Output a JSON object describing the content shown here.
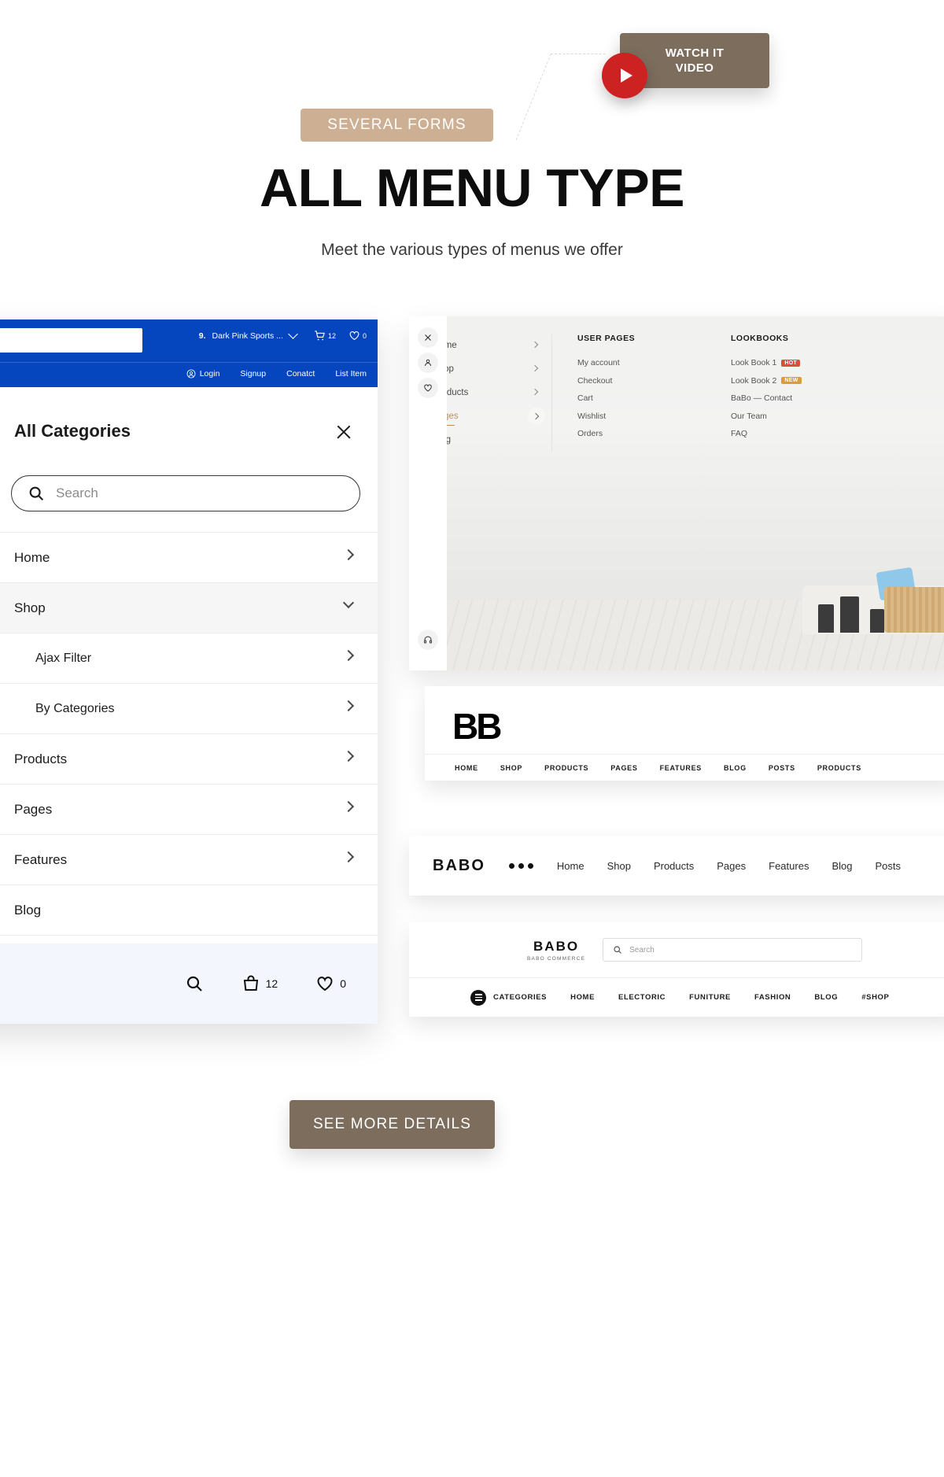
{
  "hero": {
    "watch_button": {
      "label": "WATCH IT VIDEO",
      "icon": "play-icon"
    },
    "badge": "SEVERAL FORMS",
    "title": "ALL MENU TYPE",
    "subtitle": "Meet the various types of menus we offer"
  },
  "blue_nav": {
    "search_value": "",
    "search_placeholder": "",
    "product_select": {
      "index": "9.",
      "label": "Dark Pink Sports ..."
    },
    "cart": {
      "icon": "cart-icon",
      "count": "12"
    },
    "wishlist": {
      "icon": "heart-icon",
      "count": "0"
    },
    "links": [
      {
        "label": "Login",
        "icon": "user-circle-icon"
      },
      {
        "label": "Signup",
        "icon": ""
      },
      {
        "label": "Conatct",
        "icon": ""
      },
      {
        "label": "List Item",
        "icon": ""
      }
    ]
  },
  "offcanvas": {
    "title": "All Categories",
    "close_icon": "close-icon",
    "search_placeholder": "Search",
    "search_icon": "search-icon",
    "items": [
      {
        "label": "Home",
        "arrow": "chevron-right-icon",
        "sub": false,
        "active": false
      },
      {
        "label": "Shop",
        "arrow": "chevron-down-icon",
        "sub": false,
        "active": true
      },
      {
        "label": "Ajax Filter",
        "arrow": "chevron-right-icon",
        "sub": true,
        "active": false
      },
      {
        "label": "By Categories",
        "arrow": "chevron-right-icon",
        "sub": true,
        "active": false
      },
      {
        "label": "Products",
        "arrow": "chevron-right-icon",
        "sub": false,
        "active": false
      },
      {
        "label": "Pages",
        "arrow": "chevron-right-icon",
        "sub": false,
        "active": false
      },
      {
        "label": "Features",
        "arrow": "chevron-right-icon",
        "sub": false,
        "active": false
      },
      {
        "label": "Blog",
        "arrow": "",
        "sub": false,
        "active": false
      }
    ],
    "bottom_bar": {
      "search_icon": "search-icon",
      "cart": {
        "icon": "bag-icon",
        "count": "12"
      },
      "wishlist": {
        "icon": "heart-icon",
        "count": "0"
      }
    }
  },
  "mega_menu": {
    "rail": [
      "close-icon",
      "user-icon",
      "heart-icon",
      "headphones-icon"
    ],
    "main_items": [
      {
        "label": "Home",
        "selected": false
      },
      {
        "label": "Shop",
        "selected": false
      },
      {
        "label": "Products",
        "selected": false
      },
      {
        "label": "Pages",
        "selected": true
      },
      {
        "label": "Blog",
        "selected": false
      }
    ],
    "columns": [
      {
        "heading": "USER PAGES",
        "items": [
          {
            "label": "My account",
            "tag": ""
          },
          {
            "label": "Checkout",
            "tag": ""
          },
          {
            "label": "Cart",
            "tag": ""
          },
          {
            "label": "Wishlist",
            "tag": ""
          },
          {
            "label": "Orders",
            "tag": ""
          }
        ]
      },
      {
        "heading": "LOOKBOOKS",
        "items": [
          {
            "label": "Look Book 1",
            "tag": "HOT"
          },
          {
            "label": "Look Book 2",
            "tag": "NEW"
          },
          {
            "label": "BaBo — Contact",
            "tag": ""
          },
          {
            "label": "Our Team",
            "tag": ""
          },
          {
            "label": "FAQ",
            "tag": ""
          }
        ]
      }
    ]
  },
  "bb_card": {
    "logo": "BB",
    "nav": [
      "HOME",
      "SHOP",
      "PRODUCTS",
      "PAGES",
      "FEATURES",
      "BLOG",
      "POSTS",
      "PRODUCTS"
    ]
  },
  "babo_card": {
    "logo": "BABO",
    "dots_icon": "more-dots-icon",
    "nav": [
      "Home",
      "Shop",
      "Products",
      "Pages",
      "Features",
      "Blog",
      "Posts"
    ]
  },
  "commerce_card": {
    "logo_main": "BABO",
    "logo_sub": "BABO COMMERCE",
    "search_placeholder": "Search",
    "search_icon": "search-icon",
    "categories_label": "CATEGORIES",
    "categories_icon": "hamburger-icon",
    "nav": [
      "HOME",
      "ELECTORIC",
      "FUNITURE",
      "FASHION",
      "BLOG",
      "#SHOP"
    ]
  },
  "cta": {
    "label": "SEE MORE DETAILS"
  },
  "colors": {
    "accent_brown": "#7d6d5d",
    "badge_tan": "#cdb094",
    "blue": "#0546bf",
    "play_red": "#cc2222",
    "gold": "#b8925f"
  }
}
